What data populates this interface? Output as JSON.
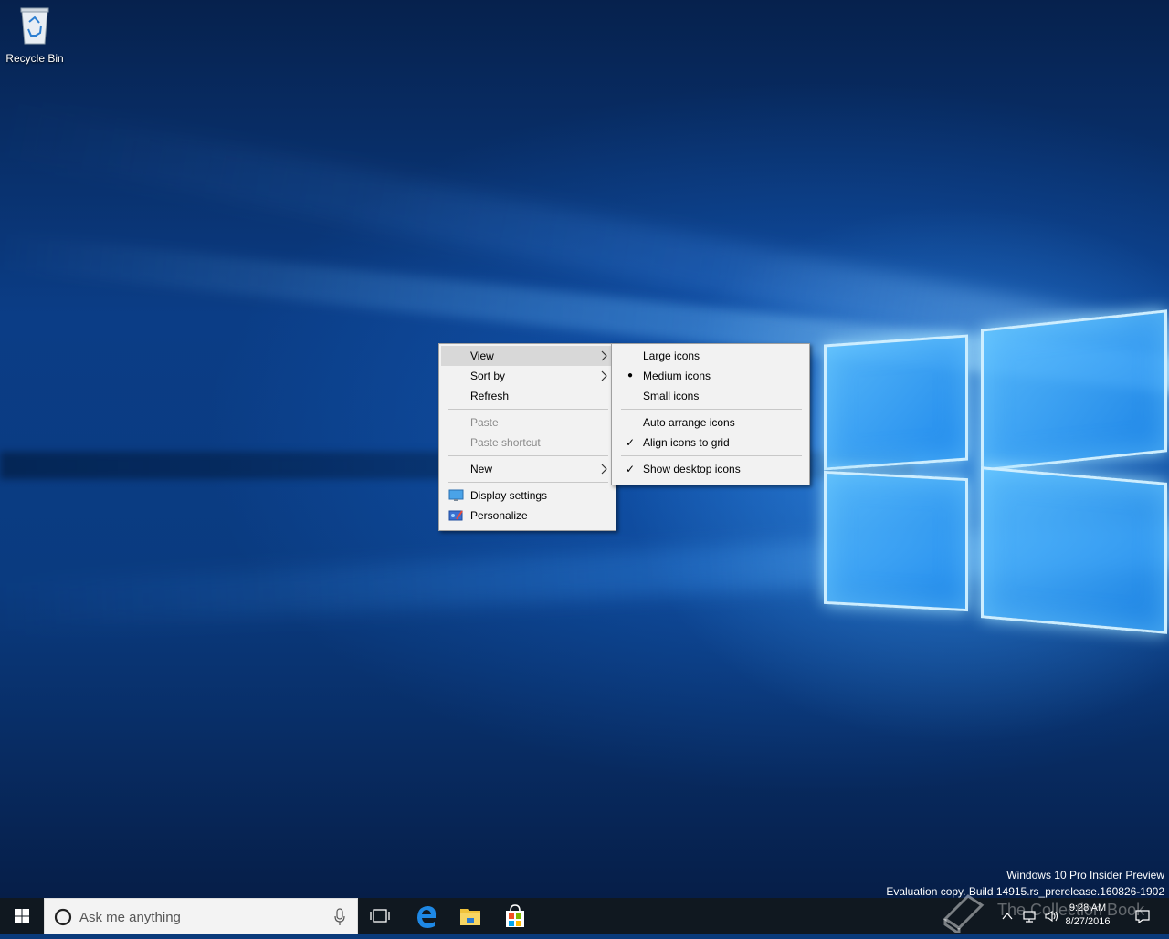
{
  "desktop": {
    "icons": [
      {
        "label": "Recycle Bin",
        "icon": "recycle-bin-icon"
      }
    ]
  },
  "context_menu": {
    "items": [
      {
        "label": "View",
        "submenu": true,
        "highlighted": true
      },
      {
        "label": "Sort by",
        "submenu": true
      },
      {
        "label": "Refresh"
      },
      {
        "label": "Paste",
        "disabled": true
      },
      {
        "label": "Paste shortcut",
        "disabled": true
      },
      {
        "label": "New",
        "submenu": true
      },
      {
        "label": "Display settings",
        "icon": "display-settings-icon"
      },
      {
        "label": "Personalize",
        "icon": "personalize-icon"
      }
    ]
  },
  "view_submenu": {
    "items": [
      {
        "label": "Large icons"
      },
      {
        "label": "Medium icons",
        "mark": "●"
      },
      {
        "label": "Small icons"
      },
      {
        "label": "Auto arrange icons"
      },
      {
        "label": "Align icons to grid",
        "mark": "✓"
      },
      {
        "label": "Show desktop icons",
        "mark": "✓"
      }
    ]
  },
  "watermark": {
    "line1": "Windows 10 Pro Insider Preview",
    "line2": "Evaluation copy. Build 14915.rs_prerelease.160826-1902"
  },
  "taskbar": {
    "search_placeholder": "Ask me anything",
    "pinned": [
      "task-view-icon",
      "edge-icon",
      "file-explorer-icon",
      "store-icon"
    ],
    "clock_time": "9:28 AM",
    "clock_date": "8/27/2016"
  },
  "overlay_watermark": "The Collection Book",
  "colors": {
    "taskbar": "#101820",
    "menu_bg": "#f2f2f2",
    "menu_highlight": "#d8d8d8",
    "accent": "#0078d7"
  }
}
